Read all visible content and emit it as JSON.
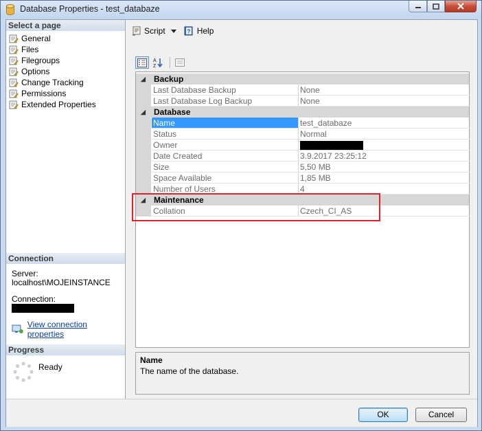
{
  "window": {
    "title": "Database Properties - test_databaze"
  },
  "sidebar": {
    "select_page_header": "Select a page",
    "items": [
      {
        "label": "General",
        "icon": "page-wrench-icon"
      },
      {
        "label": "Files",
        "icon": "page-wrench-icon"
      },
      {
        "label": "Filegroups",
        "icon": "page-wrench-icon"
      },
      {
        "label": "Options",
        "icon": "page-wrench-icon"
      },
      {
        "label": "Change Tracking",
        "icon": "page-wrench-icon"
      },
      {
        "label": "Permissions",
        "icon": "page-wrench-icon"
      },
      {
        "label": "Extended Properties",
        "icon": "page-wrench-icon"
      }
    ],
    "connection_header": "Connection",
    "server_label": "Server:",
    "server_value": "localhost\\MOJEINSTANCE",
    "connection_label": "Connection:",
    "view_connection_link": "View connection properties",
    "progress_header": "Progress",
    "progress_status": "Ready"
  },
  "toolbar": {
    "script_label": "Script",
    "help_label": "Help"
  },
  "property_grid": {
    "categories": [
      {
        "name": "Backup",
        "rows": [
          {
            "key": "Last Database Backup",
            "value": "None"
          },
          {
            "key": "Last Database Log Backup",
            "value": "None"
          }
        ]
      },
      {
        "name": "Database",
        "rows": [
          {
            "key": "Name",
            "value": "test_databaze"
          },
          {
            "key": "Status",
            "value": "Normal"
          },
          {
            "key": "Owner",
            "value": ""
          },
          {
            "key": "Date Created",
            "value": "3.9.2017 23:25:12"
          },
          {
            "key": "Size",
            "value": "5,50 MB"
          },
          {
            "key": "Space Available",
            "value": "1,85 MB"
          },
          {
            "key": "Number of Users",
            "value": "4"
          }
        ]
      },
      {
        "name": "Maintenance",
        "rows": [
          {
            "key": "Collation",
            "value": "Czech_CI_AS"
          }
        ]
      }
    ]
  },
  "description": {
    "title": "Name",
    "text": "The name of the database."
  },
  "buttons": {
    "ok": "OK",
    "cancel": "Cancel"
  },
  "colors": {
    "selection": "#3399ff",
    "highlight_box": "#e0232b",
    "link": "#0a3ea8"
  }
}
